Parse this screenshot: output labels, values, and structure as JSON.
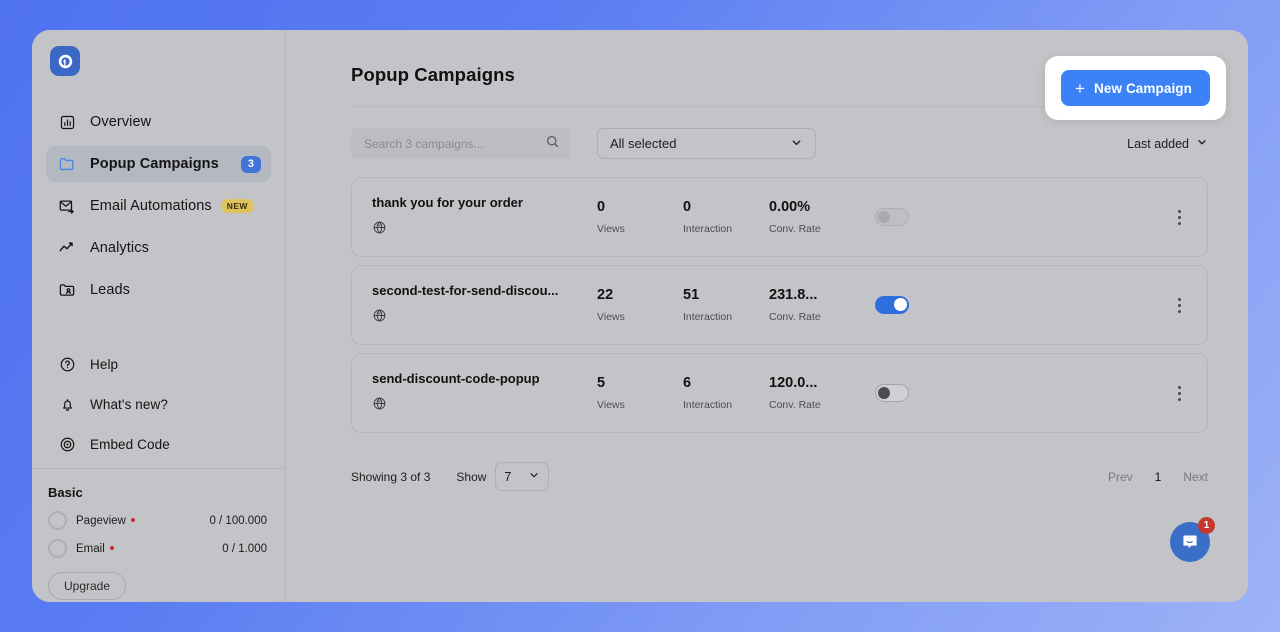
{
  "brand": {
    "logo_name": "popupsmart-logo",
    "accent": "#3b82f6"
  },
  "sidebar": {
    "primary_items": [
      {
        "label": "Overview",
        "icon": "chart-bar-icon",
        "badge": null,
        "tag": null,
        "active": false
      },
      {
        "label": "Popup Campaigns",
        "icon": "folder-icon",
        "badge": "3",
        "tag": null,
        "active": true
      },
      {
        "label": "Email Automations",
        "icon": "mail-forward-icon",
        "badge": null,
        "tag": "NEW",
        "active": false
      },
      {
        "label": "Analytics",
        "icon": "line-chart-icon",
        "badge": null,
        "tag": null,
        "active": false
      },
      {
        "label": "Leads",
        "icon": "contact-card-icon",
        "badge": null,
        "tag": null,
        "active": false
      }
    ],
    "secondary_items": [
      {
        "label": "Help",
        "icon": "question-circle-icon"
      },
      {
        "label": "What's new?",
        "icon": "bell-icon"
      },
      {
        "label": "Embed Code",
        "icon": "broadcast-icon"
      }
    ],
    "plan": {
      "title": "Basic",
      "quotas": [
        {
          "name": "Pageview",
          "value": "0 / 100.000"
        },
        {
          "name": "Email",
          "value": "0 / 1.000"
        }
      ],
      "upgrade_label": "Upgrade"
    }
  },
  "header": {
    "title": "Popup Campaigns",
    "new_campaign_label": "New Campaign",
    "new_campaign_plus": "+"
  },
  "toolbar": {
    "search_placeholder": "Search 3 campaigns...",
    "search_value": "",
    "search_icon": "search-icon",
    "filter_selected": "All selected",
    "sort_label": "Last added"
  },
  "campaigns": [
    {
      "name": "thank you for your order",
      "platform_icon": "globe-icon",
      "views": "0",
      "views_label": "Views",
      "interaction": "0",
      "interaction_label": "Interaction",
      "conv_rate": "0.00%",
      "conv_rate_label": "Conv. Rate",
      "enabled": false,
      "toggle_style": "off"
    },
    {
      "name": "second-test-for-send-discou...",
      "platform_icon": "globe-icon",
      "views": "22",
      "views_label": "Views",
      "interaction": "51",
      "interaction_label": "Interaction",
      "conv_rate": "231.8...",
      "conv_rate_label": "Conv. Rate",
      "enabled": true,
      "toggle_style": "on"
    },
    {
      "name": "send-discount-code-popup",
      "platform_icon": "globe-icon",
      "views": "5",
      "views_label": "Views",
      "interaction": "6",
      "interaction_label": "Interaction",
      "conv_rate": "120.0...",
      "conv_rate_label": "Conv. Rate",
      "enabled": false,
      "toggle_style": "off-dark"
    }
  ],
  "footer": {
    "showing_text": "Showing 3 of 3",
    "show_label": "Show",
    "show_value": "7",
    "prev_label": "Prev",
    "page_number": "1",
    "next_label": "Next"
  },
  "chat": {
    "icon": "chat-bubble-icon",
    "unread_count": "1"
  }
}
